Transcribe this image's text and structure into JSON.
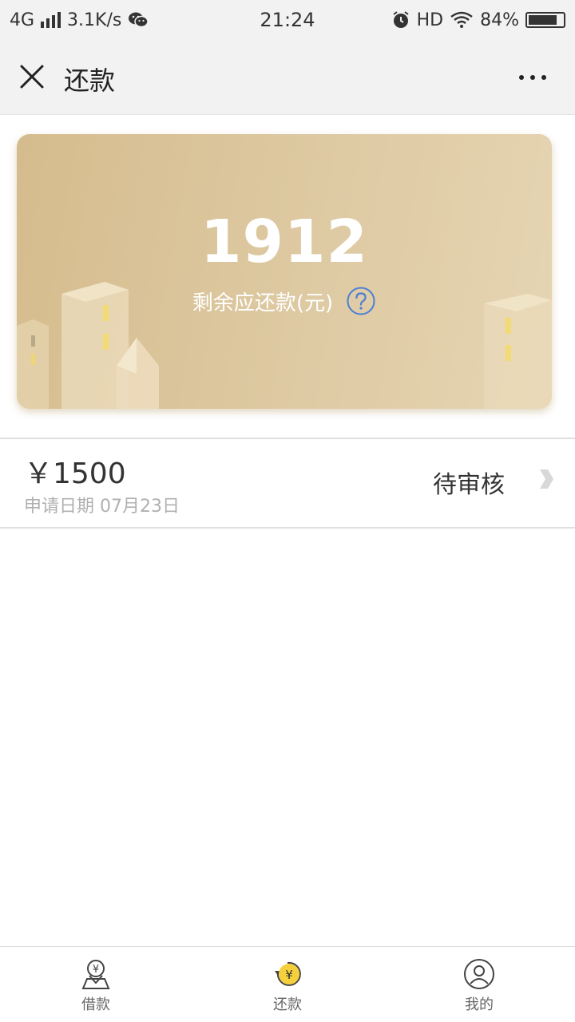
{
  "status_bar": {
    "network": "4G",
    "speed": "3.1K/s",
    "time": "21:24",
    "hd": "HD",
    "battery": "84%",
    "battery_level": 0.84,
    "icons": [
      "signal-icon",
      "wechat-icon",
      "alarm-icon",
      "wifi-icon",
      "battery-icon"
    ]
  },
  "nav": {
    "title": "还款",
    "icons": [
      "close-icon",
      "more-icon"
    ]
  },
  "card": {
    "amount": "1912",
    "label": "剩余应还款(元)",
    "colors": {
      "gradient_start": "#d5bc8d",
      "gradient_end": "#e6d5b3",
      "help_icon": "#4a7fd6"
    }
  },
  "loan_item": {
    "amount": "￥1500",
    "date": "申请日期 07月23日",
    "status": "待审核"
  },
  "tab_bar": {
    "tabs": [
      {
        "label": "借款",
        "icon": "borrow-icon"
      },
      {
        "label": "还款",
        "icon": "repay-icon"
      },
      {
        "label": "我的",
        "icon": "profile-icon"
      }
    ],
    "colors": {
      "repay_coin": "#f6cf3d"
    }
  }
}
